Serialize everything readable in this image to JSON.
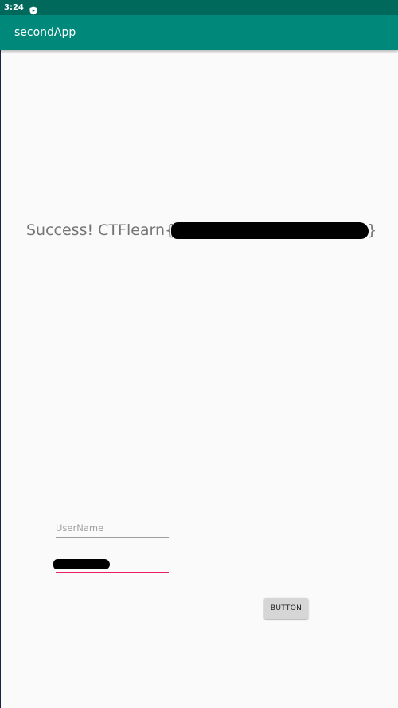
{
  "status_bar": {
    "time": "3:24",
    "icon": "play-shield-icon"
  },
  "toolbar": {
    "title": "secondApp"
  },
  "main": {
    "message_prefix": "Success! CTFlearn{",
    "message_suffix": "}"
  },
  "form": {
    "username_placeholder": "UserName",
    "username_value": "",
    "button_label": "BUTTON"
  },
  "colors": {
    "status_bar": "#00695c",
    "toolbar": "#00897b",
    "background": "#fafafa",
    "accent": "#e91e63"
  }
}
